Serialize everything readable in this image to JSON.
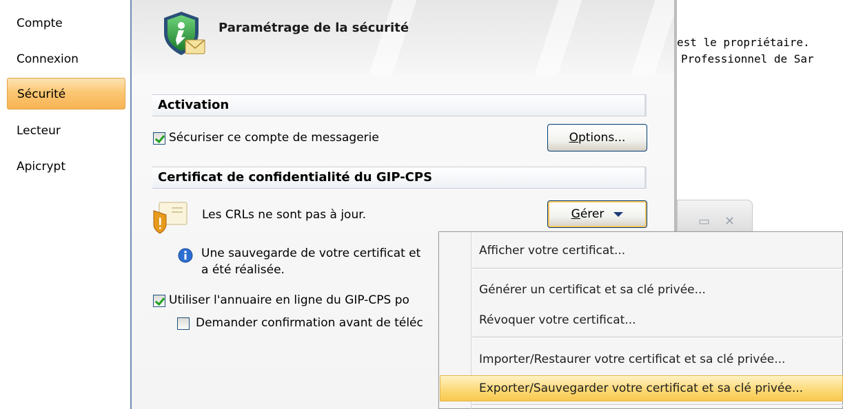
{
  "sidebar": {
    "items": [
      {
        "label": "Compte"
      },
      {
        "label": "Connexion"
      },
      {
        "label": "Sécurité",
        "selected": true
      },
      {
        "label": "Lecteur"
      },
      {
        "label": "Apicrypt"
      }
    ]
  },
  "panel": {
    "title": "Paramétrage de la sécurité",
    "activation": {
      "header": "Activation",
      "secure_checkbox_label": "Sécuriser ce compte de messagerie",
      "secure_checked": true,
      "options_button_mnemonic": "O",
      "options_button_rest": "ptions..."
    },
    "certificate": {
      "header": "Certificat de confidentialité du GIP-CPS",
      "crl_status": "Les CRLs ne sont pas à jour.",
      "manage_button_mnemonic": "G",
      "manage_button_rest": "érer",
      "backup_info_line1": "Une sauvegarde de votre certificat et",
      "backup_info_line2": "a été réalisée.",
      "directory_checkbox_label": "Utiliser l'annuaire en ligne du GIP-CPS po",
      "directory_checked": true,
      "confirm_checkbox_label": "Demander confirmation avant de téléc",
      "confirm_checked": false
    }
  },
  "background_window": {
    "line1": "est le propriétaire.",
    "line2": "Professionnel de Sar"
  },
  "context_menu": {
    "items": [
      {
        "label": "Afficher votre certificat..."
      },
      {
        "label": "Générer un certificat et sa clé privée..."
      },
      {
        "label": "Révoquer votre certificat..."
      },
      {
        "label": "Importer/Restaurer votre certificat et sa clé privée..."
      },
      {
        "label": "Exporter/Sauvegarder votre certificat et sa clé privée...",
        "highlighted": true
      }
    ]
  },
  "colors": {
    "selection_orange": "#fbc773",
    "menu_highlight": "#fcd873",
    "button_border": "#003c74"
  }
}
